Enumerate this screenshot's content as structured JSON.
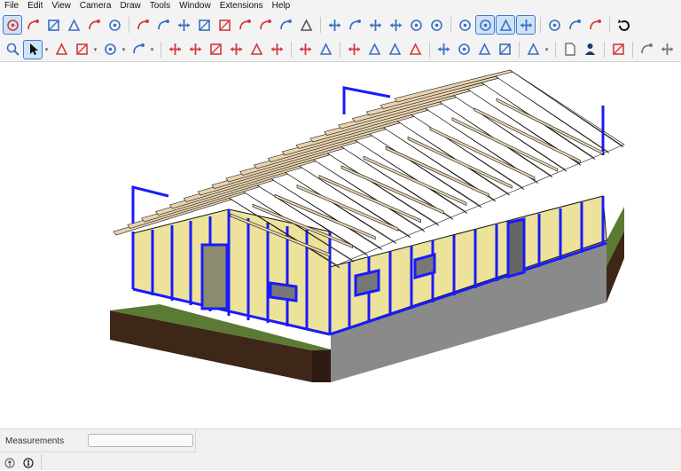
{
  "menu": [
    "File",
    "Edit",
    "View",
    "Camera",
    "Draw",
    "Tools",
    "Window",
    "Extensions",
    "Help"
  ],
  "toolbar_top": [
    {
      "type": "btn",
      "icon": "select-component-icon",
      "active": true,
      "color": "#d23b3b"
    },
    {
      "type": "btn",
      "icon": "sandbox-points-icon",
      "color": "#d23b3b"
    },
    {
      "type": "btn",
      "icon": "protractor-icon",
      "color": "#3a6fc4"
    },
    {
      "type": "btn",
      "icon": "text-label-icon",
      "color": "#3a6fc4"
    },
    {
      "type": "btn",
      "icon": "axes-icon",
      "color": "#d23b3b"
    },
    {
      "type": "btn",
      "icon": "3d-text-icon",
      "color": "#3a6fc4"
    },
    {
      "type": "sep"
    },
    {
      "type": "btn",
      "icon": "section-plane-icon",
      "color": "#d23b3b"
    },
    {
      "type": "btn",
      "icon": "pan-hand-icon",
      "color": "#3a6fc4"
    },
    {
      "type": "btn",
      "icon": "zoom-icon",
      "color": "#3a6fc4"
    },
    {
      "type": "btn",
      "icon": "zoom-window-icon",
      "color": "#3a6fc4"
    },
    {
      "type": "btn",
      "icon": "zoom-extents-icon",
      "color": "#d23b3b"
    },
    {
      "type": "btn",
      "icon": "previous-view-icon",
      "color": "#d23b3b"
    },
    {
      "type": "btn",
      "icon": "position-camera-icon",
      "color": "#d23b3b"
    },
    {
      "type": "btn",
      "icon": "look-around-icon",
      "color": "#3a6fc4"
    },
    {
      "type": "btn",
      "icon": "walk-icon",
      "color": "#555555"
    },
    {
      "type": "sep"
    },
    {
      "type": "btn",
      "icon": "iso-view-icon",
      "color": "#3a6fc4"
    },
    {
      "type": "btn",
      "icon": "top-view-icon",
      "color": "#3a6fc4"
    },
    {
      "type": "btn",
      "icon": "front-view-icon",
      "color": "#3a6fc4"
    },
    {
      "type": "btn",
      "icon": "right-view-icon",
      "color": "#3a6fc4"
    },
    {
      "type": "btn",
      "icon": "back-view-icon",
      "color": "#3a6fc4"
    },
    {
      "type": "btn",
      "icon": "left-view-icon",
      "color": "#3a6fc4"
    },
    {
      "type": "sep"
    },
    {
      "type": "btn",
      "icon": "xray-icon",
      "color": "#3a6fc4"
    },
    {
      "type": "btn",
      "icon": "wireframe-icon",
      "active": true,
      "color": "#3a6fc4"
    },
    {
      "type": "btn",
      "icon": "hidden-line-icon",
      "active": true,
      "color": "#3a6fc4"
    },
    {
      "type": "btn",
      "icon": "shaded-icon",
      "active": true,
      "color": "#3a6fc4"
    },
    {
      "type": "sep"
    },
    {
      "type": "btn",
      "icon": "component-box-icon",
      "color": "#3a6fc4"
    },
    {
      "type": "btn",
      "icon": "group-box-icon",
      "color": "#3a6fc4"
    },
    {
      "type": "btn",
      "icon": "monochrome-icon",
      "color": "#d23b3b"
    },
    {
      "type": "sep"
    },
    {
      "type": "btn",
      "icon": "refresh-icon",
      "color": "#111111"
    }
  ],
  "toolbar_bottom": [
    {
      "type": "btn",
      "icon": "search-icon",
      "color": "#3a6fc4"
    },
    {
      "type": "btn",
      "icon": "select-arrow-icon",
      "active": true,
      "color": "#111111"
    },
    {
      "type": "caret"
    },
    {
      "type": "btn",
      "icon": "eraser-icon",
      "color": "#d23b3b"
    },
    {
      "type": "btn",
      "icon": "pencil-line-icon",
      "color": "#d23b3b"
    },
    {
      "type": "caret"
    },
    {
      "type": "btn",
      "icon": "arc-icon",
      "color": "#3a6fc4"
    },
    {
      "type": "caret"
    },
    {
      "type": "btn",
      "icon": "rectangle-icon",
      "color": "#3a6fc4"
    },
    {
      "type": "caret"
    },
    {
      "type": "sep"
    },
    {
      "type": "btn",
      "icon": "push-pull-icon",
      "color": "#d23b3b"
    },
    {
      "type": "btn",
      "icon": "follow-me-icon",
      "color": "#d23b3b"
    },
    {
      "type": "btn",
      "icon": "move-icon",
      "color": "#d23b3b"
    },
    {
      "type": "btn",
      "icon": "rotate-icon",
      "color": "#d23b3b"
    },
    {
      "type": "btn",
      "icon": "scale-icon",
      "color": "#d23b3b"
    },
    {
      "type": "btn",
      "icon": "offset-icon",
      "color": "#d23b3b"
    },
    {
      "type": "sep"
    },
    {
      "type": "btn",
      "icon": "tape-measure-icon",
      "color": "#d23b3b"
    },
    {
      "type": "btn",
      "icon": "paint-bucket-icon",
      "color": "#3a6fc4"
    },
    {
      "type": "sep"
    },
    {
      "type": "btn",
      "icon": "orbit-icon",
      "color": "#d23b3b"
    },
    {
      "type": "btn",
      "icon": "pan-icon",
      "color": "#3a6fc4"
    },
    {
      "type": "btn",
      "icon": "zoom-small-icon",
      "color": "#3a6fc4"
    },
    {
      "type": "btn",
      "icon": "zoom-extents-small-icon",
      "color": "#d23b3b"
    },
    {
      "type": "sep"
    },
    {
      "type": "btn",
      "icon": "warehouse-icon",
      "color": "#3a6fc4"
    },
    {
      "type": "btn",
      "icon": "extension-warehouse-icon",
      "color": "#3a6fc4"
    },
    {
      "type": "btn",
      "icon": "layout-icon",
      "color": "#3a6fc4"
    },
    {
      "type": "btn",
      "icon": "style-builder-icon",
      "color": "#3a6fc4"
    },
    {
      "type": "sep"
    },
    {
      "type": "btn",
      "icon": "user-account-icon",
      "color": "#3a6fc4"
    },
    {
      "type": "caret"
    },
    {
      "type": "sep"
    },
    {
      "type": "btn",
      "icon": "new-file-icon",
      "color": "#555555"
    },
    {
      "type": "btn",
      "icon": "person-icon",
      "color": "#1d3a66"
    },
    {
      "type": "sep"
    },
    {
      "type": "btn",
      "icon": "stamp-icon",
      "color": "#d23b3b"
    },
    {
      "type": "sep"
    },
    {
      "type": "btn",
      "icon": "smoove-icon",
      "color": "#777777"
    },
    {
      "type": "btn",
      "icon": "drape-icon",
      "color": "#777777"
    }
  ],
  "status": {
    "measurements_label": "Measurements",
    "measurements_value": ""
  },
  "status_icons": [
    "geo-location-icon",
    "credits-icon"
  ],
  "model": {
    "stud_color": "#1a1aff",
    "sheathing_color": "#ece29a",
    "rafter_color": "#e8d3b0",
    "ground_color": "#5b7a33",
    "soil_color": "#3e2618",
    "foundation_color": "#8a8a8a"
  }
}
